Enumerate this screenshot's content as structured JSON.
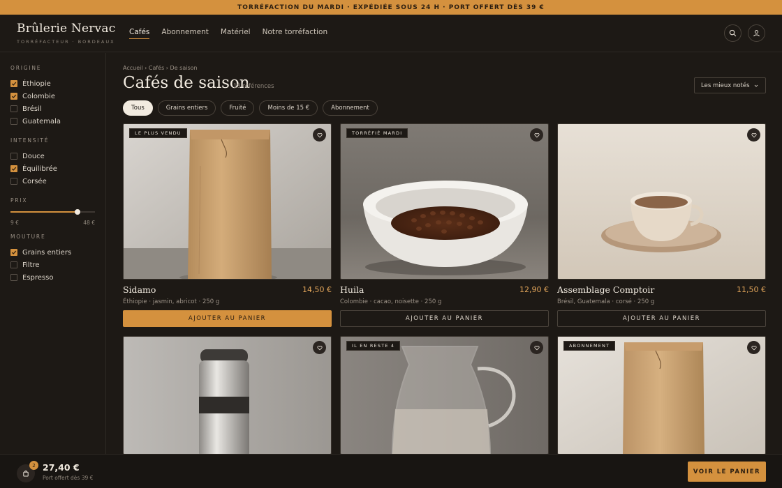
{
  "promo": "TORRÉFACTION DU MARDI · EXPÉDIÉE SOUS 24 H · PORT OFFERT DÈS 39 €",
  "brand": {
    "name": "Brûlerie Nervac",
    "tagline": "TORRÉFACTEUR · BORDEAUX"
  },
  "nav": [
    {
      "label": "Cafés",
      "active": true
    },
    {
      "label": "Abonnement"
    },
    {
      "label": "Matériel"
    },
    {
      "label": "Notre torréfaction"
    }
  ],
  "filters": {
    "origin": {
      "title": "ORIGINE",
      "items": [
        {
          "label": "Éthiopie",
          "checked": true
        },
        {
          "label": "Colombie",
          "checked": true
        },
        {
          "label": "Brésil",
          "checked": false
        },
        {
          "label": "Guatemala",
          "checked": false
        }
      ]
    },
    "intensity": {
      "title": "INTENSITÉ",
      "items": [
        {
          "label": "Douce",
          "checked": false
        },
        {
          "label": "Équilibrée",
          "checked": true
        },
        {
          "label": "Corsée",
          "checked": false
        }
      ]
    },
    "price": {
      "title": "PRIX",
      "min_label": "9 €",
      "max_label": "48 €",
      "min": 9,
      "max": 48,
      "selected_max": 40
    },
    "grind": {
      "title": "MOUTURE",
      "items": [
        {
          "label": "Grains entiers",
          "checked": true
        },
        {
          "label": "Filtre",
          "checked": false
        },
        {
          "label": "Espresso",
          "checked": false
        }
      ]
    }
  },
  "breadcrumb": "Accueil › Cafés › De saison",
  "title": "Cafés de saison",
  "count": "18 références",
  "sort": "Les mieux notés",
  "chips": [
    {
      "label": "Tous",
      "active": true
    },
    {
      "label": "Grains entiers"
    },
    {
      "label": "Fruité"
    },
    {
      "label": "Moins de 15 €"
    },
    {
      "label": "Abonnement"
    }
  ],
  "add_label": "AJOUTER AU PANIER",
  "products": [
    {
      "badge": "LE PLUS VENDU",
      "image": "kraft-bag",
      "name": "Sidamo",
      "price": "14,50 €",
      "desc": "Éthiopie · jasmin, abricot · 250 g",
      "primary": true
    },
    {
      "badge": "TORRÉFIÉ MARDI",
      "image": "bean-bowl",
      "name": "Huila",
      "price": "12,90 €",
      "desc": "Colombie · cacao, noisette · 250 g",
      "primary": false
    },
    {
      "badge": "",
      "image": "cup-saucer",
      "name": "Assemblage Comptoir",
      "price": "11,50 €",
      "desc": "Brésil, Guatemala · corsé · 250 g",
      "primary": false
    },
    {
      "badge": "",
      "image": "thermos"
    },
    {
      "badge": "IL EN RESTE 4",
      "image": "glass-carafe"
    },
    {
      "badge": "ABONNEMENT",
      "image": "kraft-bag"
    }
  ],
  "cart": {
    "count": "2",
    "total": "27,40 €",
    "note": "Port offert dès 39 €",
    "button": "VOIR LE PANIER"
  },
  "colors": {
    "accent": "#d4913e",
    "background": "#1d1915",
    "price": "#e2a55a"
  }
}
